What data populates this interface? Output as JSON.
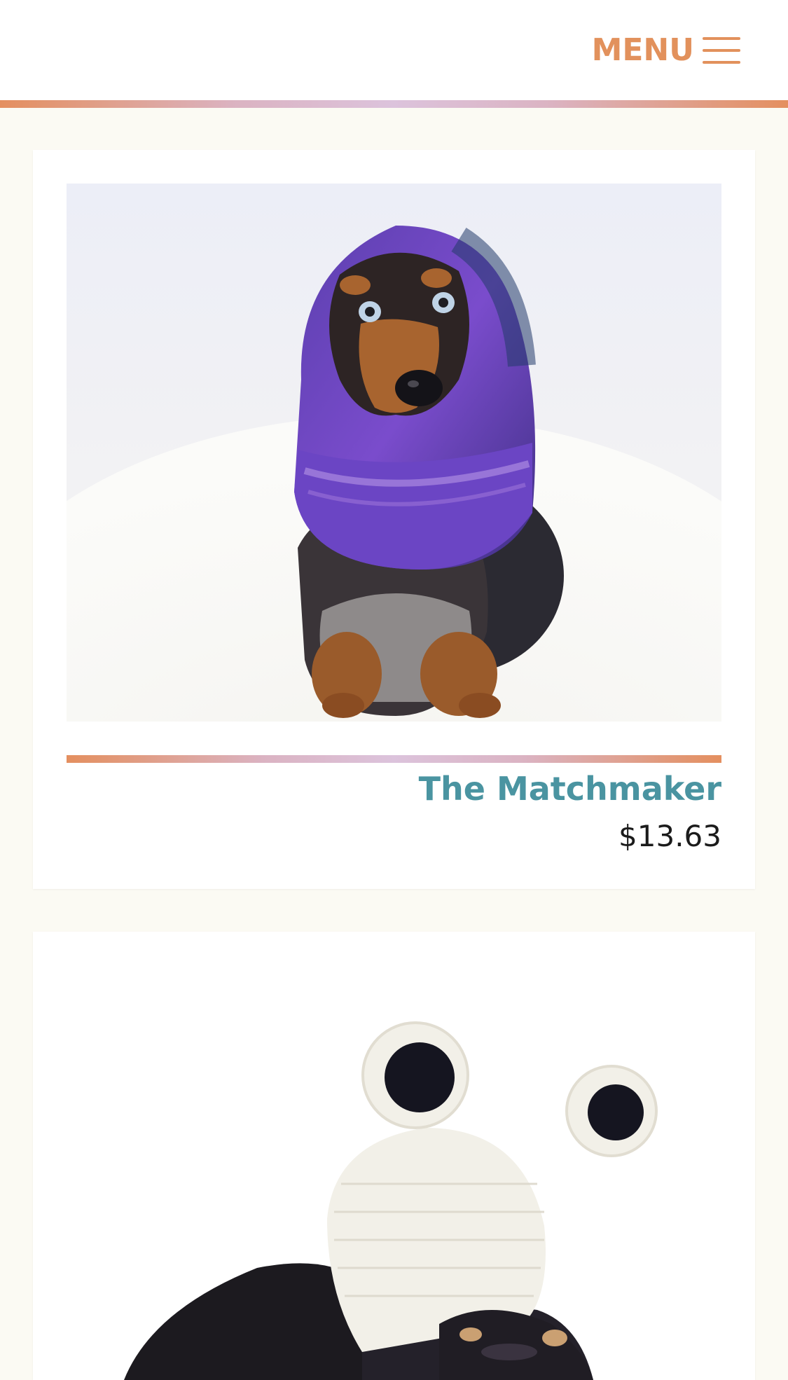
{
  "header": {
    "menu_label": "MENU",
    "menu_icon": "hamburger-icon",
    "accent_color": "#e2915c"
  },
  "products": [
    {
      "title": "The Matchmaker",
      "price": "$13.63",
      "image_icon": "product-photo-dachshund-purple-snood"
    },
    {
      "image_icon": "product-photo-dog-panda-knit-hat"
    }
  ],
  "colors": {
    "page_background": "#fbfaf3",
    "title_color": "#4a94a1",
    "price_color": "#1b1b1b",
    "rule_gradient_start": "#e48f5f",
    "rule_gradient_mid": "#dcc3dc"
  }
}
